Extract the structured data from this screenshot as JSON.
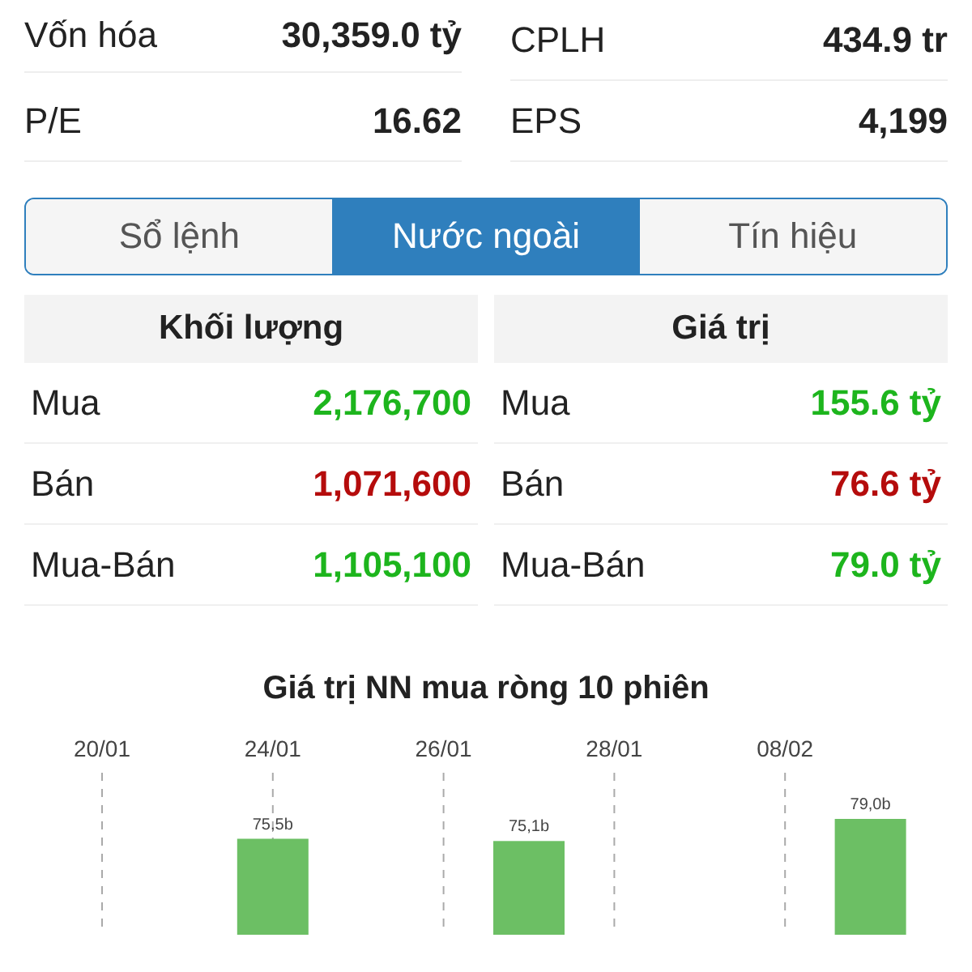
{
  "stats": [
    {
      "label": "Vốn hóa",
      "value": "30,359.0 tỷ"
    },
    {
      "label": "CPLH",
      "value": "434.9 tr"
    },
    {
      "label": "P/E",
      "value": "16.62"
    },
    {
      "label": "EPS",
      "value": "4,199"
    }
  ],
  "tabs": [
    {
      "label": "Sổ lệnh",
      "selected": false
    },
    {
      "label": "Nước ngoài",
      "selected": true
    },
    {
      "label": "Tín hiệu",
      "selected": false
    }
  ],
  "tables": [
    {
      "header": "Khối lượng",
      "rows": [
        {
          "label": "Mua",
          "value": "2,176,700",
          "color": "#1db51d"
        },
        {
          "label": "Bán",
          "value": "1,071,600",
          "color": "#b50c0c"
        },
        {
          "label": "Mua-Bán",
          "value": "1,105,100",
          "color": "#1db51d"
        }
      ]
    },
    {
      "header": "Giá trị",
      "rows": [
        {
          "label": "Mua",
          "value": "155.6 tỷ",
          "color": "#1db51d"
        },
        {
          "label": "Bán",
          "value": "76.6 tỷ",
          "color": "#b50c0c"
        },
        {
          "label": "Mua-Bán",
          "value": "79.0 tỷ",
          "color": "#1db51d"
        }
      ]
    }
  ],
  "chart": {
    "title": "Giá trị NN mua ròng 10 phiên",
    "sessions": [
      {
        "kind": "blank",
        "date": "20/01"
      },
      {
        "kind": "blank"
      },
      {
        "kind": "bar",
        "date": "24/01",
        "bar_label": "75,5b"
      },
      {
        "kind": "blank"
      },
      {
        "kind": "blank",
        "date": "26/01"
      },
      {
        "kind": "bar",
        "bar_label": "75,1b"
      },
      {
        "kind": "blank",
        "date": "28/01"
      },
      {
        "kind": "blank"
      },
      {
        "kind": "blank",
        "date": "08/02"
      },
      {
        "kind": "bar",
        "bar_label": "79,0b"
      }
    ]
  }
}
